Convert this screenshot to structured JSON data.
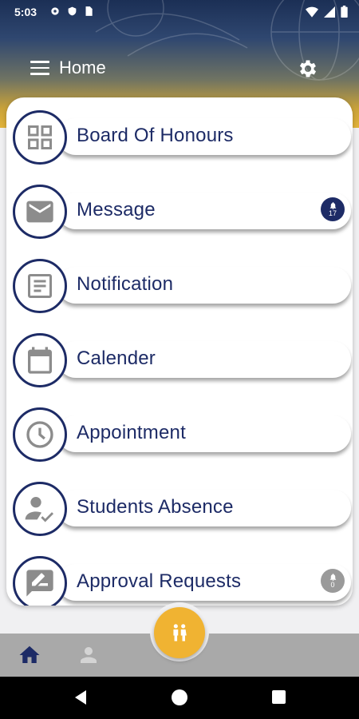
{
  "status_bar": {
    "time": "5:03"
  },
  "app_bar": {
    "title": "Home"
  },
  "menu": {
    "items": [
      {
        "label": "Board Of Honours",
        "icon": "grid-icon"
      },
      {
        "label": "Message",
        "icon": "mail-icon",
        "badge": "17",
        "badge_color": "#1d2b66"
      },
      {
        "label": "Notification",
        "icon": "document-icon"
      },
      {
        "label": "Calender",
        "icon": "calendar-icon"
      },
      {
        "label": "Appointment",
        "icon": "clock-icon"
      },
      {
        "label": "Students Absence",
        "icon": "user-check-icon"
      },
      {
        "label": "Approval Requests",
        "icon": "edit-message-icon",
        "badge": "0",
        "badge_color": "#9a9a9a"
      }
    ]
  },
  "bottom_nav": {
    "items": [
      {
        "icon": "home-icon",
        "active": true
      },
      {
        "icon": "profile-icon",
        "active": false
      }
    ],
    "fab_icon": "family-icon"
  },
  "colors": {
    "accent": "#1d2b66",
    "fab": "#f0b332",
    "icon_grey": "#8c8c8c"
  }
}
